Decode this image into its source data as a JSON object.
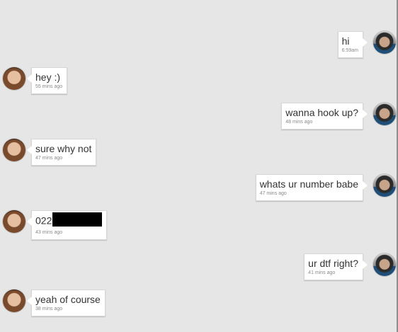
{
  "messages": [
    {
      "side": "right",
      "text": "hi",
      "time": "6:59am"
    },
    {
      "side": "left",
      "text": "hey :)",
      "time": "55 mins ago"
    },
    {
      "side": "right",
      "text": "wanna hook up?",
      "time": "48 mins ago"
    },
    {
      "side": "left",
      "text": "sure why not",
      "time": "47 mins ago"
    },
    {
      "side": "right",
      "text": "whats ur number babe",
      "time": "47 mins ago"
    },
    {
      "side": "left",
      "text": "022",
      "time": "43 mins ago",
      "redacted": true
    },
    {
      "side": "right",
      "text": "ur dtf right?",
      "time": "41 mins ago"
    },
    {
      "side": "left",
      "text": "yeah of course",
      "time": "38 mins ago"
    }
  ]
}
